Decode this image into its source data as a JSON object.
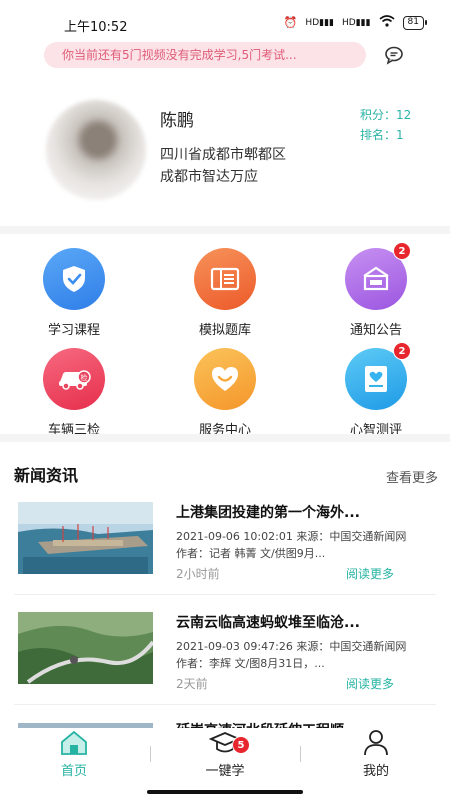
{
  "status_bar": {
    "time": "上午10:52",
    "battery": "81",
    "signal1": "HD",
    "signal2": "HD"
  },
  "notice": {
    "text": "你当前还有5门视频没有完成学习,5门考试..."
  },
  "profile": {
    "name": "陈鹏",
    "address_line1": "四川省成都市郫都区",
    "address_line2": "成都市智达万应",
    "score_label": "积分：12",
    "rank_label": "排名：1"
  },
  "grid": {
    "items": [
      {
        "label": "学习课程",
        "icon": "shield-check-icon",
        "color": "#3a8ef0",
        "badge": ""
      },
      {
        "label": "模拟题库",
        "icon": "question-bank-icon",
        "color": "#f0713a",
        "badge": ""
      },
      {
        "label": "通知公告",
        "icon": "notice-board-icon",
        "color": "#b06ce8",
        "badge": "2"
      },
      {
        "label": "车辆三检",
        "icon": "vehicle-check-icon",
        "color": "#f0455f",
        "badge": ""
      },
      {
        "label": "服务中心",
        "icon": "heart-service-icon",
        "color": "#f6a93a",
        "badge": ""
      },
      {
        "label": "心智测评",
        "icon": "mind-evaluation-icon",
        "color": "#35b4ef",
        "badge": "2"
      }
    ]
  },
  "news": {
    "section_title": "新闻资讯",
    "more_label": "查看更多",
    "items": [
      {
        "title": "上港集团投建的第一个海外...",
        "meta": "2021-09-06 10:02:01 来源：中国交通新闻网 作者：记者 韩菁 文/供图9月...",
        "ago": "2小时前",
        "read_more": "阅读更多"
      },
      {
        "title": "云南云临高速蚂蚁堆至临沧...",
        "meta": "2021-09-03 09:47:26 来源：中国交通新闻网 作者：李辉 文/图8月31日，...",
        "ago": "2天前",
        "read_more": "阅读更多"
      },
      {
        "title": "延崇高速河北段延伸工程顺...",
        "meta": "",
        "ago": "",
        "read_more": ""
      }
    ]
  },
  "tabbar": {
    "tabs": [
      {
        "label": "首页",
        "active": true
      },
      {
        "label": "一键学",
        "active": false,
        "badge": "5"
      },
      {
        "label": "我的",
        "active": false
      }
    ]
  },
  "colors": {
    "accent": "#26b3a2",
    "notice_bg": "#fbe3e7",
    "notice_text": "#e05c78",
    "badge": "#e8262d"
  }
}
